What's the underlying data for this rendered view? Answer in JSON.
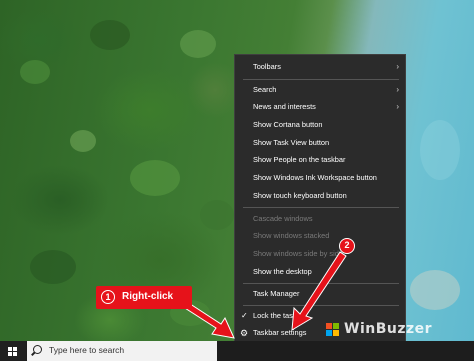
{
  "context_menu": {
    "items": [
      {
        "label": "Toolbars",
        "submenu": true,
        "disabled": false
      },
      {
        "label": "Search",
        "submenu": true,
        "disabled": false
      },
      {
        "label": "News and interests",
        "submenu": true,
        "disabled": false
      },
      {
        "label": "Show Cortana button",
        "submenu": false,
        "disabled": false
      },
      {
        "label": "Show Task View button",
        "submenu": false,
        "disabled": false
      },
      {
        "label": "Show People on the taskbar",
        "submenu": false,
        "disabled": false
      },
      {
        "label": "Show Windows Ink Workspace button",
        "submenu": false,
        "disabled": false
      },
      {
        "label": "Show touch keyboard button",
        "submenu": false,
        "disabled": false
      },
      {
        "label": "Cascade windows",
        "submenu": false,
        "disabled": true
      },
      {
        "label": "Show windows stacked",
        "submenu": false,
        "disabled": true
      },
      {
        "label": "Show windows side by side",
        "submenu": false,
        "disabled": true
      },
      {
        "label": "Show the desktop",
        "submenu": false,
        "disabled": false
      },
      {
        "label": "Task Manager",
        "submenu": false,
        "disabled": false
      },
      {
        "label": "Lock the taskbar",
        "submenu": false,
        "disabled": false,
        "checked": true
      },
      {
        "label": "Taskbar settings",
        "submenu": false,
        "disabled": false,
        "icon": "gear-icon"
      }
    ]
  },
  "taskbar": {
    "search_placeholder": "Type here to search",
    "start_icon": "windows-logo-icon"
  },
  "callouts": {
    "step1_number": "1",
    "step1_label": "Right-click",
    "step2_number": "2"
  },
  "watermark": {
    "text": "WinBuzzer"
  },
  "colors": {
    "menu_bg": "#2b2b2b",
    "callout_red": "#e6121a",
    "taskbar_bg": "#1d1d1d"
  }
}
